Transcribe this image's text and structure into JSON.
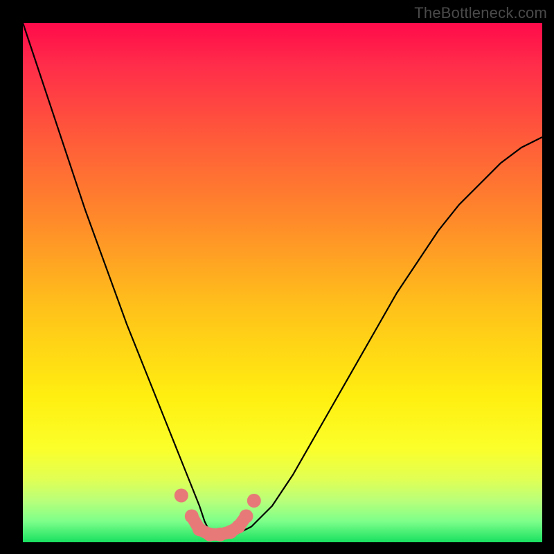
{
  "watermark": "TheBottleneck.com",
  "colors": {
    "frame": "#000000",
    "curve_stroke": "#000000",
    "marker_fill": "#e77a78",
    "marker_stroke": "#c45a58"
  },
  "chart_data": {
    "type": "line",
    "title": "",
    "xlabel": "",
    "ylabel": "",
    "xlim": [
      0,
      100
    ],
    "ylim": [
      0,
      100
    ],
    "grid": false,
    "legend": false,
    "x": [
      0,
      4,
      8,
      12,
      16,
      20,
      24,
      28,
      30,
      32,
      34,
      35,
      36,
      38,
      40,
      44,
      48,
      52,
      56,
      60,
      64,
      68,
      72,
      76,
      80,
      84,
      88,
      92,
      96,
      100
    ],
    "values": [
      100,
      88,
      76,
      64,
      53,
      42,
      32,
      22,
      17,
      12,
      7,
      4,
      2,
      1,
      1,
      3,
      7,
      13,
      20,
      27,
      34,
      41,
      48,
      54,
      60,
      65,
      69,
      73,
      76,
      78
    ],
    "markers": {
      "x": [
        30.5,
        32.5,
        34.0,
        36.0,
        38.0,
        40.0,
        41.5,
        43.0,
        44.5
      ],
      "y": [
        9.0,
        5.0,
        2.5,
        1.5,
        1.5,
        2.0,
        3.0,
        5.0,
        8.0
      ]
    }
  }
}
